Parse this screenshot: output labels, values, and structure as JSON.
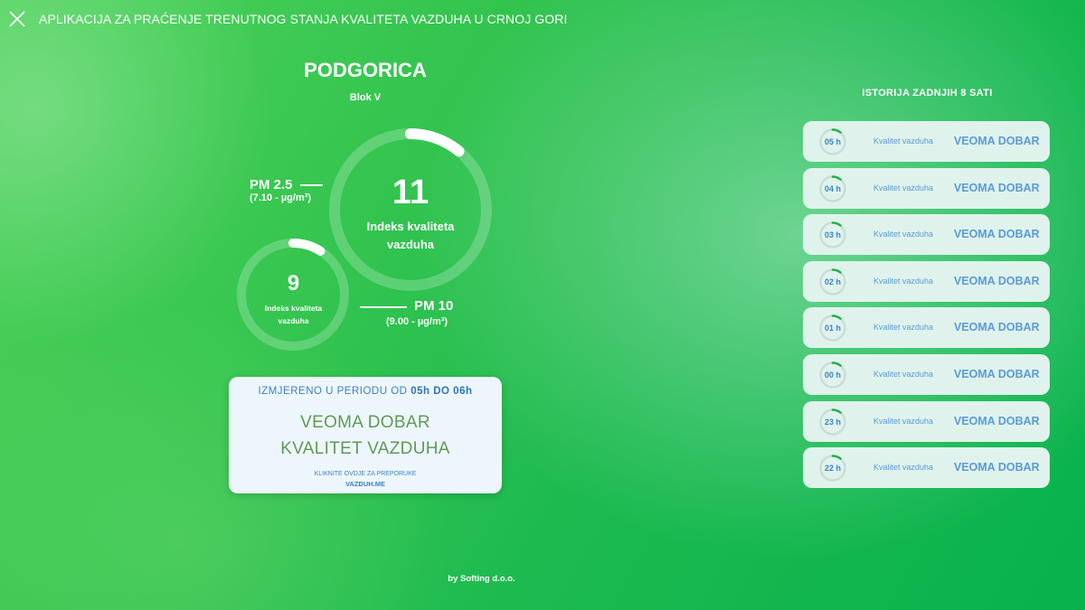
{
  "header": {
    "title": "APLIKACIJA ZA PRAĆENJE TRENUTNOG STANJA KVALITETA VAZDUHA U CRNOJ GORI",
    "close_icon": "close-icon"
  },
  "location": {
    "city": "PODGORICA",
    "station": "Blok V"
  },
  "pm25": {
    "name": "PM 2.5",
    "detail": "(7.10 - µg/m³)",
    "index": "11",
    "index_label_1": "Indeks kvaliteta",
    "index_label_2": "vazduha",
    "gauge_fraction": 0.11
  },
  "pm10": {
    "name": "PM 10",
    "detail": "(9.00 - µg/m³)",
    "index": "9",
    "index_label_1": "Indeks kvaliteta",
    "index_label_2": "vazduha",
    "gauge_fraction": 0.09
  },
  "measurement": {
    "period_prefix": "IZMJERENO U PERIODU OD",
    "period_from": "05h",
    "period_sep": "DO",
    "period_to": "06h",
    "quality_line1": "VEOMA DOBAR",
    "quality_line2": "KVALITET VAZDUHA",
    "recommendation": "KLIKNITE OVDJE ZA PREPORUKE",
    "link": "VAZDUH.ME"
  },
  "history": {
    "title": "ISTORIJA ZADNJIH 8 SATI",
    "items": [
      {
        "hour": "05 h",
        "label": "Kvalitet vazduha",
        "status": "VEOMA DOBAR",
        "fraction": 0.11
      },
      {
        "hour": "04 h",
        "label": "Kvalitet vazduha",
        "status": "VEOMA DOBAR",
        "fraction": 0.11
      },
      {
        "hour": "03 h",
        "label": "Kvalitet vazduha",
        "status": "VEOMA DOBAR",
        "fraction": 0.11
      },
      {
        "hour": "02 h",
        "label": "Kvalitet vazduha",
        "status": "VEOMA DOBAR",
        "fraction": 0.11
      },
      {
        "hour": "01 h",
        "label": "Kvalitet vazduha",
        "status": "VEOMA DOBAR",
        "fraction": 0.11
      },
      {
        "hour": "00 h",
        "label": "Kvalitet vazduha",
        "status": "VEOMA DOBAR",
        "fraction": 0.11
      },
      {
        "hour": "23 h",
        "label": "Kvalitet vazduha",
        "status": "VEOMA DOBAR",
        "fraction": 0.11
      },
      {
        "hour": "22 h",
        "label": "Kvalitet vazduha",
        "status": "VEOMA DOBAR",
        "fraction": 0.11
      }
    ]
  },
  "footer": {
    "text": "by Softing d.o.o."
  },
  "colors": {
    "accent_green": "#22b14c",
    "text_blue": "#3b82c8",
    "quality_green": "#5f9a55",
    "card_bg": "#eef6fd",
    "history_bg": "#dff3ec"
  }
}
